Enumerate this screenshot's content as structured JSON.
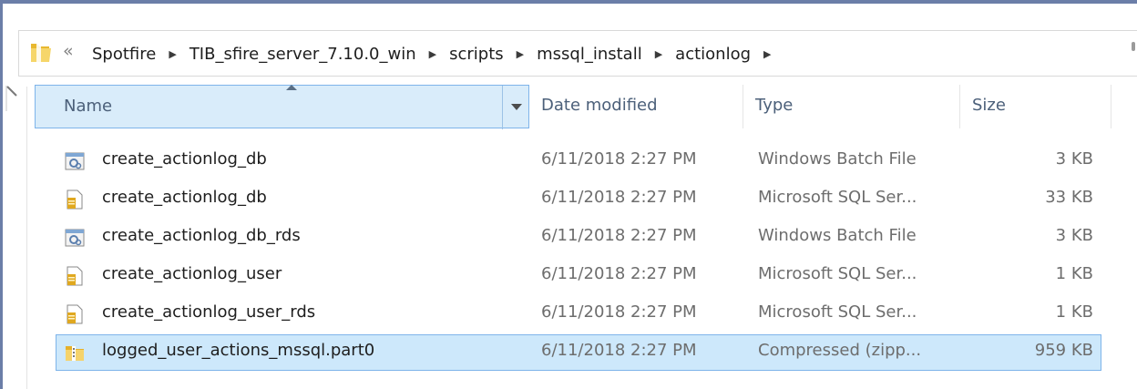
{
  "address_bar": {
    "overflow_glyph": "«",
    "breadcrumbs": [
      {
        "label": "Spotfire"
      },
      {
        "label": "TIB_sfire_server_7.10.0_win"
      },
      {
        "label": "scripts"
      },
      {
        "label": "mssql_install"
      },
      {
        "label": "actionlog"
      }
    ],
    "separator": "▶"
  },
  "columns": {
    "name": "Name",
    "date": "Date modified",
    "type": "Type",
    "size": "Size"
  },
  "files": [
    {
      "name": "create_actionlog_db",
      "date": "6/11/2018 2:27 PM",
      "type": "Windows Batch File",
      "size": "3 KB",
      "icon": "batch-file-icon",
      "selected": false
    },
    {
      "name": "create_actionlog_db",
      "date": "6/11/2018 2:27 PM",
      "type": "Microsoft SQL Ser...",
      "size": "33 KB",
      "icon": "sql-file-icon",
      "selected": false
    },
    {
      "name": "create_actionlog_db_rds",
      "date": "6/11/2018 2:27 PM",
      "type": "Windows Batch File",
      "size": "3 KB",
      "icon": "batch-file-icon",
      "selected": false
    },
    {
      "name": "create_actionlog_user",
      "date": "6/11/2018 2:27 PM",
      "type": "Microsoft SQL Ser...",
      "size": "1 KB",
      "icon": "sql-file-icon",
      "selected": false
    },
    {
      "name": "create_actionlog_user_rds",
      "date": "6/11/2018 2:27 PM",
      "type": "Microsoft SQL Ser...",
      "size": "1 KB",
      "icon": "sql-file-icon",
      "selected": false
    },
    {
      "name": "logged_user_actions_mssql.part0",
      "date": "6/11/2018 2:27 PM",
      "type": "Compressed (zipp...",
      "size": "959 KB",
      "icon": "zip-folder-icon",
      "selected": true
    }
  ],
  "colors": {
    "selection_fill": "#cde8fb",
    "selection_border": "#7eb4ea",
    "header_text": "#4c607a",
    "secondary_text": "#6d6d6d"
  }
}
